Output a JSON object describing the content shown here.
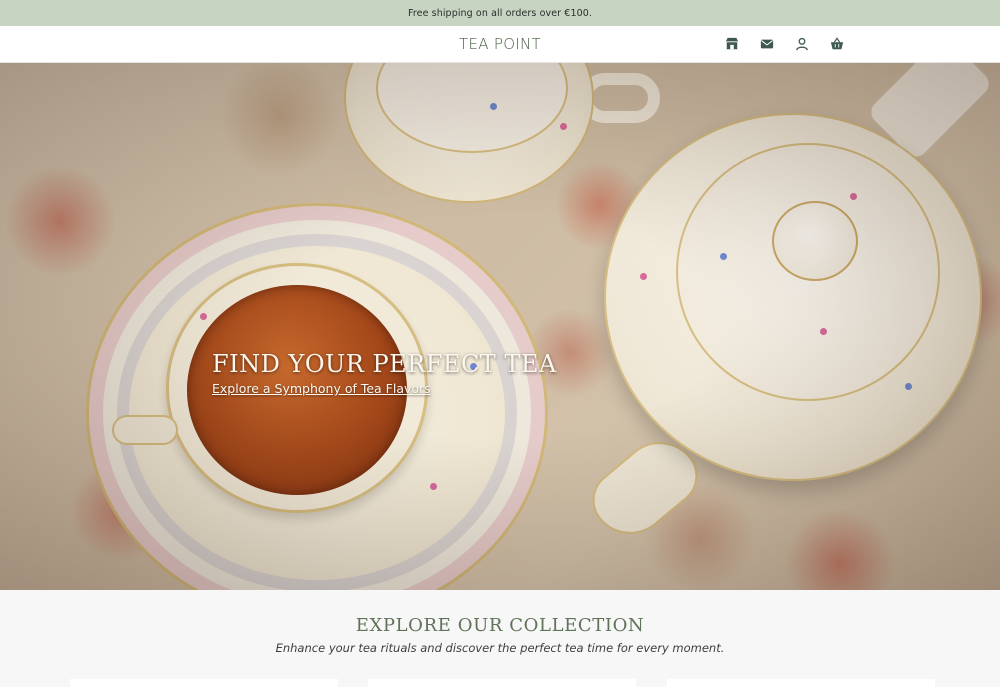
{
  "announcement": {
    "text": "Free shipping on all orders over €100."
  },
  "header": {
    "brand": "TEA POINT",
    "icons": [
      "store-icon",
      "envelope-icon",
      "user-icon",
      "basket-icon"
    ]
  },
  "hero": {
    "title": "FIND YOUR PERFECT TEA",
    "link": "Explore a Symphony of Tea Flavors"
  },
  "collection": {
    "title": "EXPLORE OUR COLLECTION",
    "subtitle": "Enhance your tea rituals and discover the perfect tea time for every moment."
  },
  "colors": {
    "announcement_bg": "#c7d4c1",
    "brand_green": "#4a5c44",
    "section_title_green": "#5f7358"
  }
}
